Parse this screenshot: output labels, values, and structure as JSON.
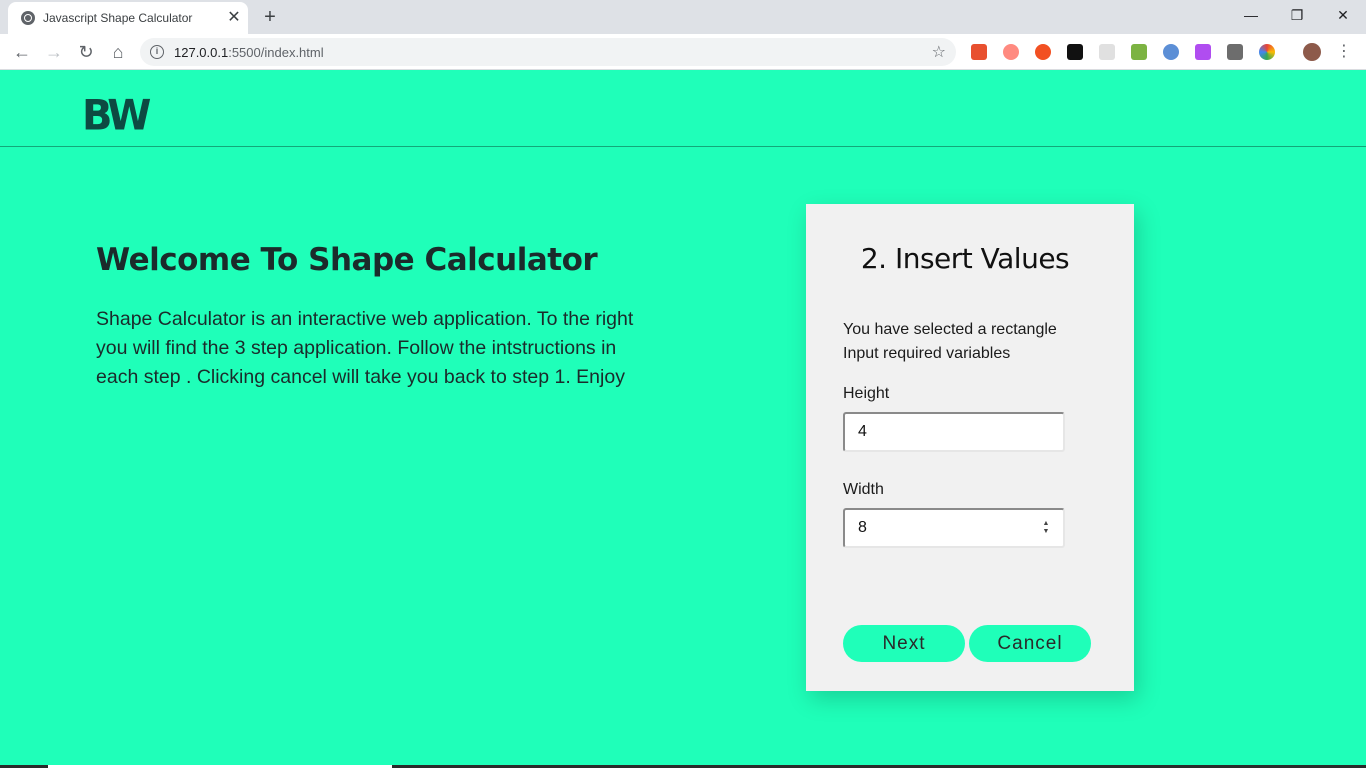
{
  "browser": {
    "tab_title": "Javascript Shape Calculator",
    "url_host": "127.0.0.1",
    "url_rest": ":5500/index.html"
  },
  "header": {
    "logo": "BW"
  },
  "welcome": {
    "title": "Welcome To Shape Calculator",
    "text": "Shape Calculator is an interactive web application. To the right you will find the 3 step application. Follow the intstructions in each step . Clicking cancel will take you back to step 1. Enjoy"
  },
  "card": {
    "title": "2. Insert Values",
    "selected_text": "You have selected a rectangle",
    "required_text": "Input required variables",
    "height_label": "Height",
    "height_value": "4",
    "width_label": "Width",
    "width_value": "8",
    "next_label": "Next",
    "cancel_label": "Cancel"
  },
  "colors": {
    "page_bg": "#1fffb9",
    "logo": "#0d4a42",
    "card_bg": "#f1f1f1",
    "button_bg": "#1fffb9"
  }
}
